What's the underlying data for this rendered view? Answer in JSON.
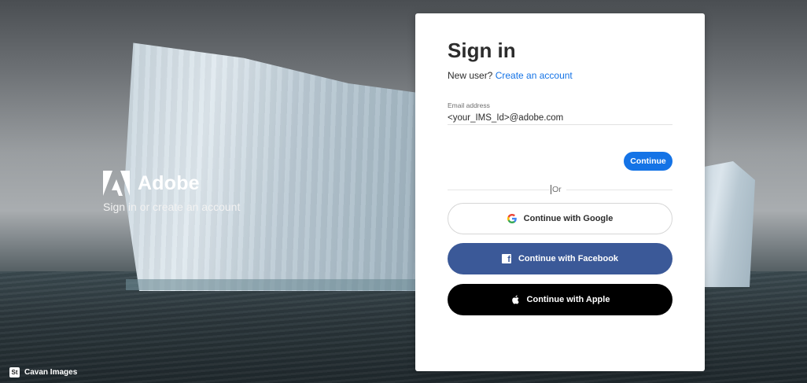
{
  "brand": {
    "name": "Adobe",
    "tagline": "Sign in or create an account",
    "logo_icon": "adobe-logo-icon"
  },
  "credit": {
    "badge": "St",
    "text": "Cavan Images"
  },
  "signin": {
    "title": "Sign in",
    "new_user_prefix": "New user?",
    "create_account_link": "Create an account",
    "email_label": "Email address",
    "email_value": "<your_IMS_Id>@adobe.com",
    "continue_label": "Continue",
    "or_label": "Or",
    "google_label": "Continue with Google",
    "facebook_label": "Continue with Facebook",
    "apple_label": "Continue with Apple"
  },
  "colors": {
    "accent": "#1473e6",
    "facebook": "#3b5998",
    "apple": "#000000"
  }
}
